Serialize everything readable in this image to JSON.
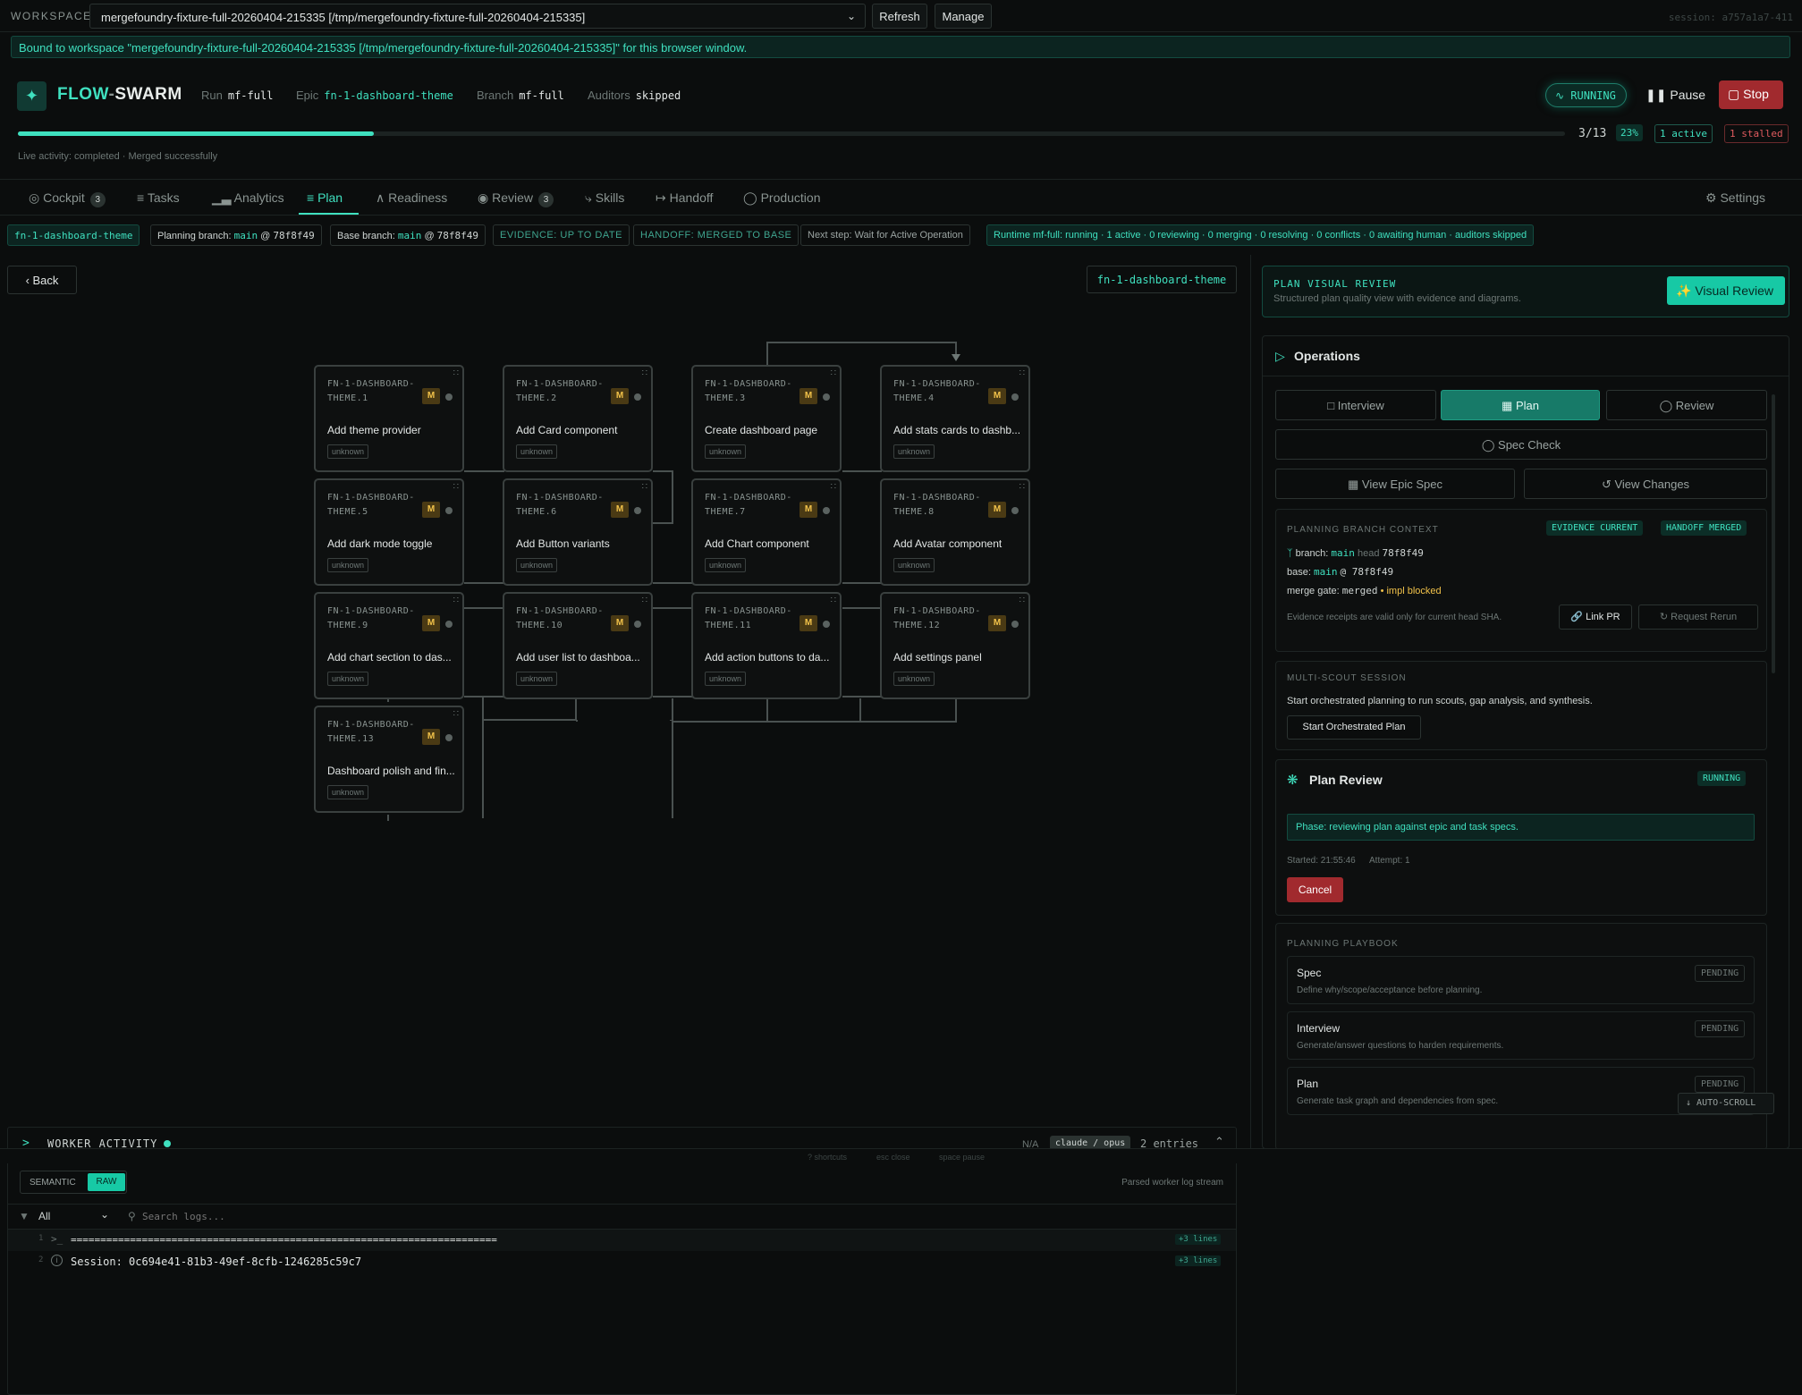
{
  "workspace": {
    "label": "WORKSPACE",
    "selected": "mergefoundry-fixture-full-20260404-215335 [/tmp/mergefoundry-fixture-full-20260404-215335]",
    "refresh": "Refresh",
    "manage": "Manage",
    "session": "session: a757a1a7-411",
    "bound_msg": "Bound to workspace \"mergefoundry-fixture-full-20260404-215335 [/tmp/mergefoundry-fixture-full-20260404-215335]\" for this browser window."
  },
  "header": {
    "brand_1": "FLOW",
    "brand_sep": "-",
    "brand_2": "SWARM",
    "run_label": "Run",
    "run": "mf-full",
    "epic_label": "Epic",
    "epic": "fn-1-dashboard-theme",
    "branch_label": "Branch",
    "branch": "mf-full",
    "auditors_label": "Auditors",
    "auditors": "skipped",
    "status": "RUNNING",
    "pause": "Pause",
    "stop": "Stop",
    "progress": 0.23,
    "progress_count": "3/13",
    "progress_pct": "23%",
    "active": "1 active",
    "stalled": "1 stalled",
    "live_activity": "Live activity: completed · Merged successfully"
  },
  "tabs": [
    {
      "label": "Cockpit",
      "count": "3",
      "icon": "gauge-icon"
    },
    {
      "label": "Tasks",
      "icon": "list-icon"
    },
    {
      "label": "Analytics",
      "icon": "bar-chart-icon"
    },
    {
      "label": "Plan",
      "icon": "plan-icon",
      "active": true
    },
    {
      "label": "Readiness",
      "icon": "readiness-icon"
    },
    {
      "label": "Review",
      "count": "3",
      "icon": "eye-icon"
    },
    {
      "label": "Skills",
      "icon": "lightning-icon"
    },
    {
      "label": "Handoff",
      "icon": "handoff-icon"
    },
    {
      "label": "Production",
      "icon": "shield-icon"
    }
  ],
  "settings": "Settings",
  "context": {
    "epic": "fn-1-dashboard-theme",
    "planning_label": "Planning branch:",
    "planning_branch": "main",
    "planning_sha": "78f8f49",
    "base_label": "Base branch:",
    "base_branch": "main",
    "base_sha": "78f8f49",
    "evidence": "EVIDENCE: UP TO DATE",
    "handoff": "HANDOFF: MERGED TO BASE",
    "next_step": "Next step: Wait for Active Operation",
    "runtime": "Runtime mf-full: running · 1 active · 0 reviewing · 0 merging · 0 resolving · 0 conflicts · 0 awaiting human · auditors skipped"
  },
  "plan": {
    "back": "Back",
    "epic_tag": "fn-1-dashboard-theme",
    "nodes": [
      {
        "id": "FN-1-DASHBOARD-THEME.1",
        "title": "Add theme provider",
        "status": "unknown",
        "model": "M"
      },
      {
        "id": "FN-1-DASHBOARD-THEME.2",
        "title": "Add Card component",
        "status": "unknown",
        "model": "M"
      },
      {
        "id": "FN-1-DASHBOARD-THEME.3",
        "title": "Create dashboard page",
        "status": "unknown",
        "model": "M"
      },
      {
        "id": "FN-1-DASHBOARD-THEME.4",
        "title": "Add stats cards to dashb...",
        "status": "unknown",
        "model": "M"
      },
      {
        "id": "FN-1-DASHBOARD-THEME.5",
        "title": "Add dark mode toggle",
        "status": "unknown",
        "model": "M"
      },
      {
        "id": "FN-1-DASHBOARD-THEME.6",
        "title": "Add Button variants",
        "status": "unknown",
        "model": "M"
      },
      {
        "id": "FN-1-DASHBOARD-THEME.7",
        "title": "Add Chart component",
        "status": "unknown",
        "model": "M"
      },
      {
        "id": "FN-1-DASHBOARD-THEME.8",
        "title": "Add Avatar component",
        "status": "unknown",
        "model": "M"
      },
      {
        "id": "FN-1-DASHBOARD-THEME.9",
        "title": "Add chart section to das...",
        "status": "unknown",
        "model": "M"
      },
      {
        "id": "FN-1-DASHBOARD-THEME.10",
        "title": "Add user list to dashboa...",
        "status": "unknown",
        "model": "M"
      },
      {
        "id": "FN-1-DASHBOARD-THEME.11",
        "title": "Add action buttons to da...",
        "status": "unknown",
        "model": "M"
      },
      {
        "id": "FN-1-DASHBOARD-THEME.12",
        "title": "Add settings panel",
        "status": "unknown",
        "model": "M"
      },
      {
        "id": "FN-1-DASHBOARD-THEME.13",
        "title": "Dashboard polish and fin...",
        "status": "unknown",
        "model": "M"
      }
    ]
  },
  "worker": {
    "title": "WORKER ACTIVITY",
    "na": "N/A",
    "model": "claude / opus",
    "entries": "2 entries",
    "semantic": "SEMANTIC",
    "raw": "RAW",
    "parsed": "Parsed worker log stream",
    "filter": "All",
    "search_placeholder": "Search logs...",
    "lines": [
      {
        "n": "1",
        "text": "========================================================================",
        "more": "+3 lines"
      },
      {
        "n": "2",
        "text": "Session: 0c694e41-81b3-49ef-8cfb-1246285c59c7",
        "more": "+3 lines"
      }
    ]
  },
  "right": {
    "pvr_title": "PLAN VISUAL REVIEW",
    "pvr_sub": "Structured plan quality view with evidence and diagrams.",
    "pvr_button": "Visual Review",
    "ops_title": "Operations",
    "op_interview": "Interview",
    "op_plan": "Plan",
    "op_review": "Review",
    "op_spec": "Spec Check",
    "view_epic": "View Epic Spec",
    "view_changes": "View Changes",
    "pbc_title": "PLANNING BRANCH CONTEXT",
    "evidence_current": "EVIDENCE CURRENT",
    "handoff_merged": "HANDOFF MERGED",
    "branch_label": "branch:",
    "branch": "main",
    "head_label": "head",
    "head": "78f8f49",
    "base_label": "base:",
    "base_branch": "main",
    "base_sha": "@ 78f8f49",
    "merge_label": "merge gate:",
    "merge_val": "merged",
    "impl": "• impl blocked",
    "receipts": "Evidence receipts are valid only for current head SHA.",
    "link_pr": "Link PR",
    "request_rerun": "Request Rerun",
    "ms_title": "MULTI-SCOUT SESSION",
    "ms_desc": "Start orchestrated planning to run scouts, gap analysis, and synthesis.",
    "ms_button": "Start Orchestrated Plan",
    "pr_title": "Plan Review",
    "pr_status": "RUNNING",
    "pr_phase": "Phase: reviewing plan against epic and task specs.",
    "pr_started": "Started: 21:55:46",
    "pr_attempt": "Attempt: 1",
    "pr_cancel": "Cancel",
    "pp_title": "PLANNING PLAYBOOK",
    "playbook": [
      {
        "name": "Spec",
        "desc": "Define why/scope/acceptance before planning.",
        "status": "PENDING"
      },
      {
        "name": "Interview",
        "desc": "Generate/answer questions to harden requirements.",
        "status": "PENDING"
      },
      {
        "name": "Plan",
        "desc": "Generate task graph and dependencies from spec.",
        "status": "PENDING"
      }
    ],
    "autoscroll": "AUTO-SCROLL"
  },
  "footer": {
    "hint1": "? shortcuts",
    "hint2": "esc close",
    "hint3": "space pause"
  }
}
